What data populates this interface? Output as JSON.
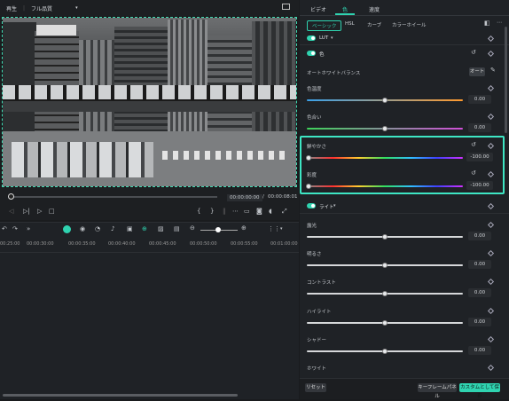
{
  "player": {
    "play_label": "再生",
    "quality": "フル品質",
    "current_time": "00:00:00:00",
    "separator": "/",
    "total_time": "00:00:08:01"
  },
  "timeline": {
    "ticks": [
      "00:25:00",
      "00:00:30:00",
      "00:00:35:00",
      "00:00:40:00",
      "00:00:45:00",
      "00:00:50:00",
      "00:00:55:00",
      "00:01:00:00"
    ]
  },
  "panel": {
    "tabs": [
      "ビデオ",
      "色",
      "速度"
    ],
    "subtabs": [
      "ベーシック",
      "HSL",
      "カーブ",
      "カラーホイール"
    ],
    "lut_label": "LUT",
    "color_label": "色",
    "awb_label": "オートホワイトバランス",
    "auto_btn": "オート",
    "temp_label": "色温度",
    "temp_value": "0.00",
    "tint_label": "色合い",
    "tint_value": "0.00",
    "vibrance_label": "鮮やかさ",
    "vibrance_value": "-100.00",
    "saturation_label": "彩度",
    "saturation_value": "-100.00",
    "light_label": "ライト",
    "exposure_label": "露光",
    "exposure_value": "0.00",
    "brightness_label": "明るさ",
    "brightness_value": "0.00",
    "contrast_label": "コントラスト",
    "contrast_value": "0.00",
    "highlight_label": "ハイライト",
    "highlight_value": "0.00",
    "shadow_label": "シャドー",
    "shadow_value": "0.00",
    "white_label": "ホワイト",
    "reset_btn": "リセット",
    "keyframe_btn": "キーフレームパネル",
    "save_custom_btn": "カスタムとして保存"
  },
  "colors": {
    "accent": "#2fd3b0",
    "highlight_border": "#3ee6c4"
  }
}
